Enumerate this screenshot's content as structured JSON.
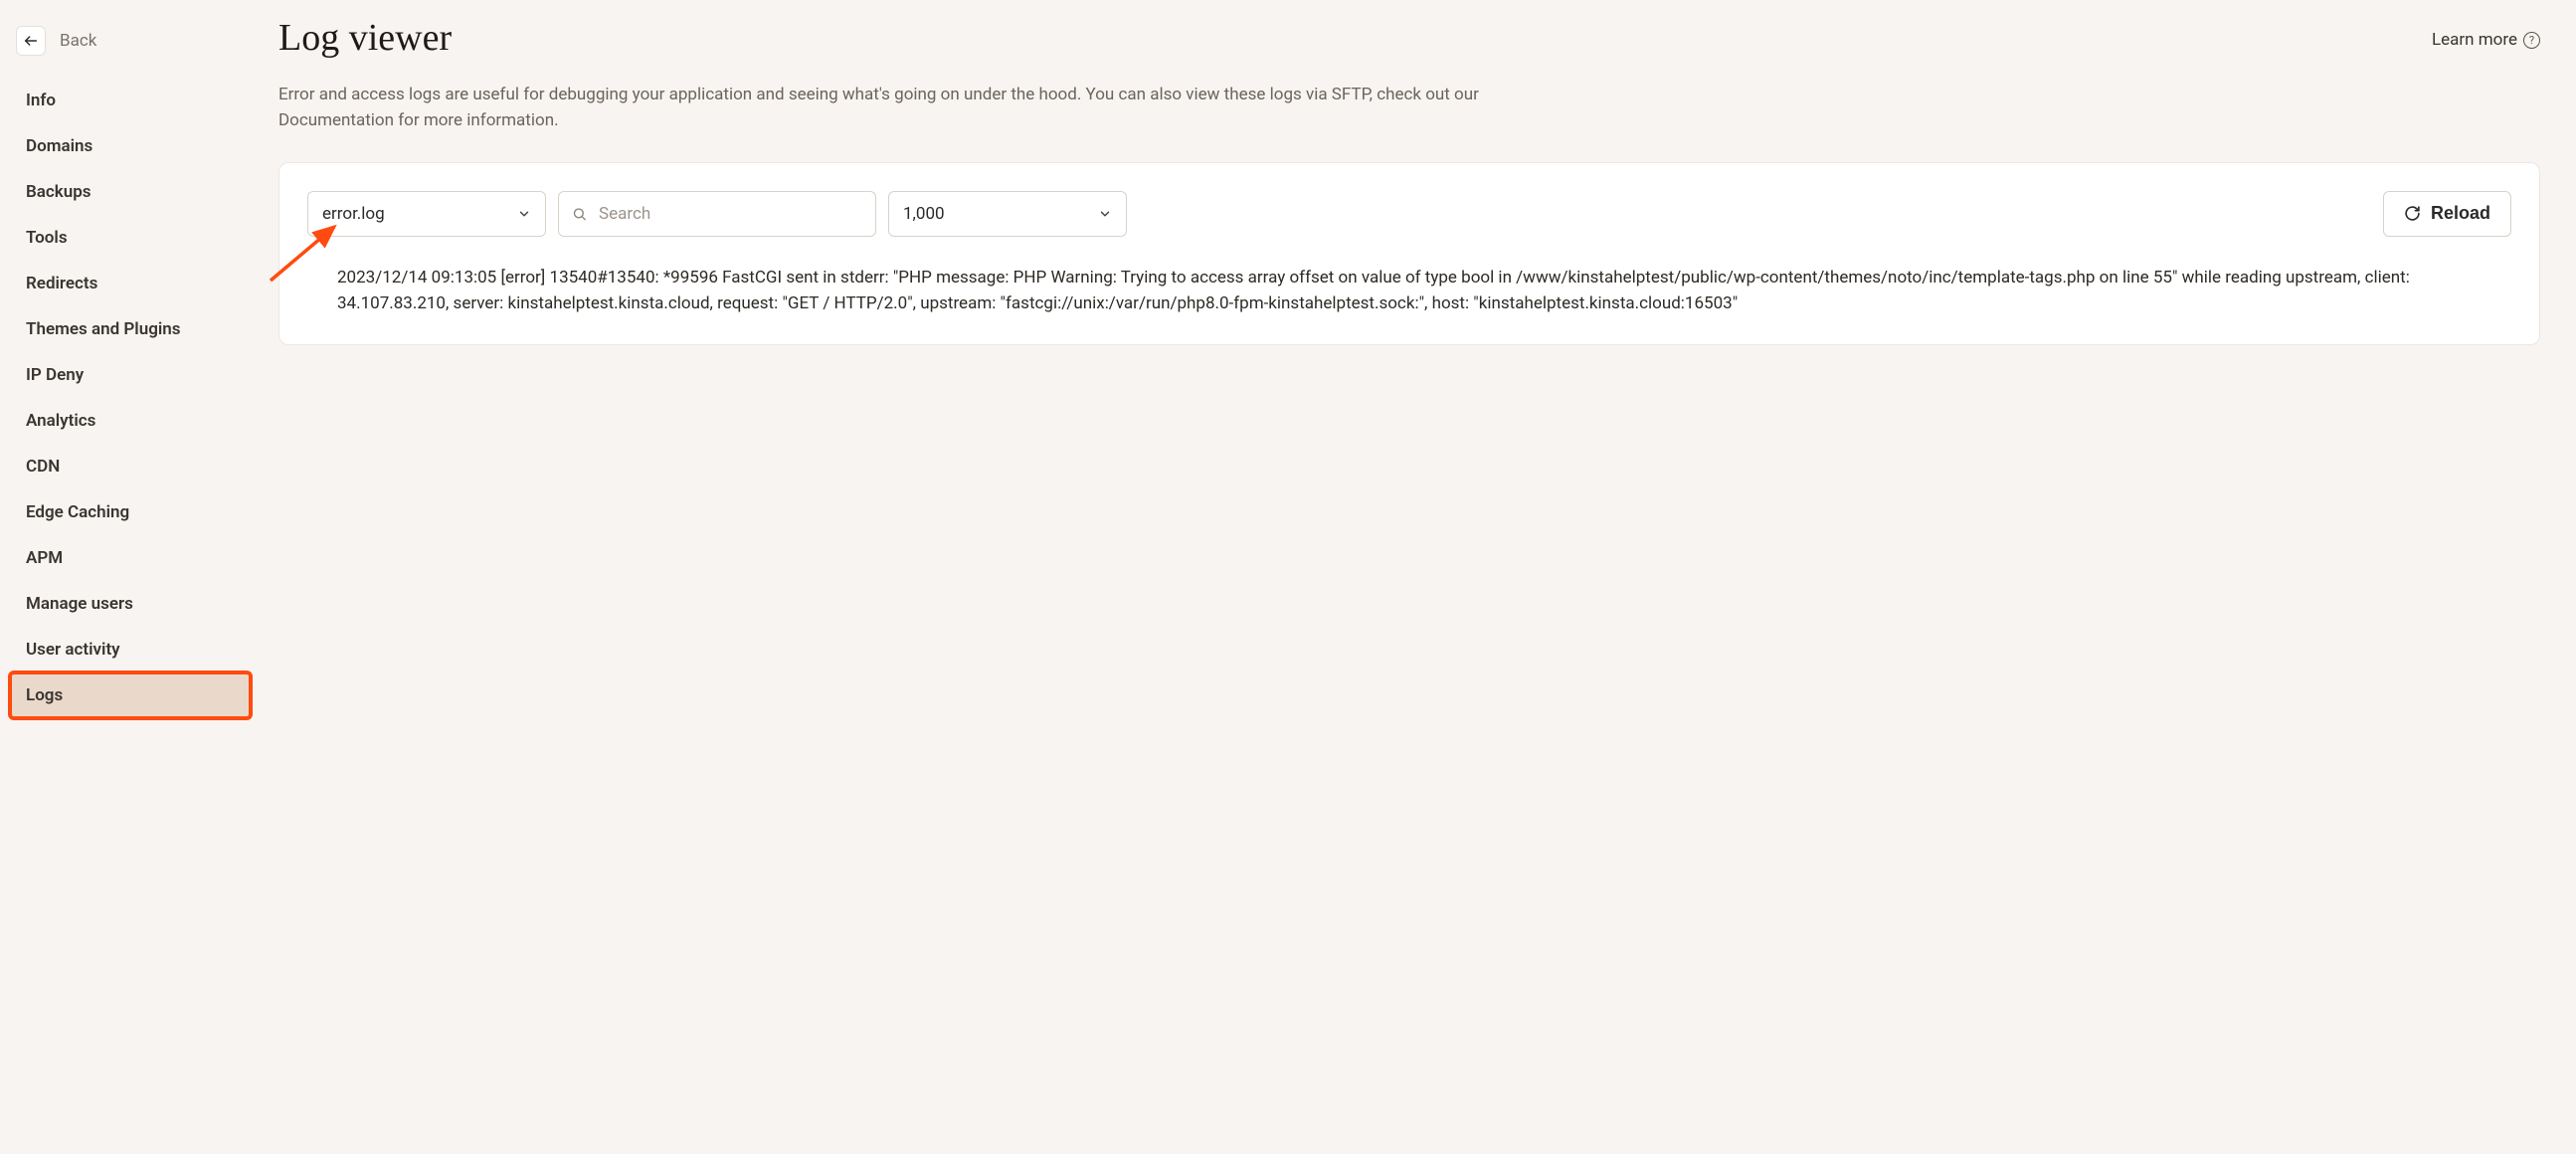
{
  "sidebar": {
    "back_label": "Back",
    "items": [
      {
        "label": "Info",
        "active": false
      },
      {
        "label": "Domains",
        "active": false
      },
      {
        "label": "Backups",
        "active": false
      },
      {
        "label": "Tools",
        "active": false
      },
      {
        "label": "Redirects",
        "active": false
      },
      {
        "label": "Themes and Plugins",
        "active": false
      },
      {
        "label": "IP Deny",
        "active": false
      },
      {
        "label": "Analytics",
        "active": false
      },
      {
        "label": "CDN",
        "active": false
      },
      {
        "label": "Edge Caching",
        "active": false
      },
      {
        "label": "APM",
        "active": false
      },
      {
        "label": "Manage users",
        "active": false
      },
      {
        "label": "User activity",
        "active": false
      },
      {
        "label": "Logs",
        "active": true
      }
    ]
  },
  "header": {
    "title": "Log viewer",
    "learn_more": "Learn more"
  },
  "description": "Error and access logs are useful for debugging your application and seeing what's going on under the hood. You can also view these logs via SFTP, check out our Documentation for more information.",
  "toolbar": {
    "log_file_selected": "error.log",
    "search_placeholder": "Search",
    "lines_selected": "1,000",
    "reload_label": "Reload"
  },
  "logs": {
    "entries": [
      "2023/12/14 09:13:05 [error] 13540#13540: *99596 FastCGI sent in stderr: \"PHP message: PHP Warning: Trying to access array offset on value of type bool in /www/kinstahelptest/public/wp-content/themes/noto/inc/template-tags.php on line 55\" while reading upstream, client: 34.107.83.210, server: kinstahelptest.kinsta.cloud, request: \"GET / HTTP/2.0\", upstream: \"fastcgi://unix:/var/run/php8.0-fpm-kinstahelptest.sock:\", host: \"kinstahelptest.kinsta.cloud:16503\""
    ]
  }
}
